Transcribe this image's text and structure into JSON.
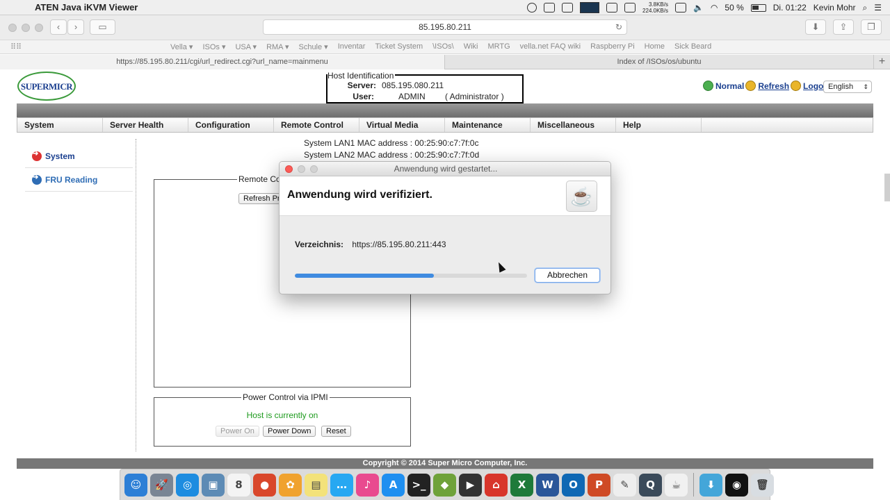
{
  "menubar": {
    "app_name": "ATEN Java iKVM Viewer",
    "net_up": "3.8KB/s",
    "net_down": "224.0KB/s",
    "battery": "50 %",
    "clock": "Di. 01:22",
    "user": "Kevin Mohr"
  },
  "browser": {
    "url": "85.195.80.211",
    "favorites": [
      "Vella ▾",
      "ISOs ▾",
      "USA ▾",
      "RMA ▾",
      "Schule ▾",
      "Inventar",
      "Ticket System",
      "\\ISOs\\",
      "Wiki",
      "MRTG",
      "vella.net FAQ wiki",
      "Raspberry Pi",
      "Home",
      "Sick Beard"
    ],
    "tabs": [
      "https://85.195.80.211/cgi/url_redirect.cgi?url_name=mainmenu",
      "Index of /ISOs/os/ubuntu"
    ]
  },
  "page": {
    "logo_text": "SUPERMICR",
    "host_legend": "Host Identification",
    "server_label": "Server:",
    "server_value": "085.195.080.211",
    "user_label": "User:",
    "user_value": "ADMIN",
    "user_role": "( Administrator )",
    "link_normal": "Normal",
    "link_refresh": "Refresh",
    "link_logout": "Logout",
    "language": "English",
    "nav": [
      "System",
      "Server Health",
      "Configuration",
      "Remote Control",
      "Virtual Media",
      "Maintenance",
      "Miscellaneous",
      "Help"
    ],
    "sidebar": [
      "System",
      "FRU Reading"
    ],
    "mac_lan1": "System LAN1 MAC address : 00:25:90:c7:7f:0c",
    "mac_lan2": "System LAN2 MAC address : 00:25:90:c7:7f:0d",
    "remote_legend": "Remote Co",
    "refresh_preview": "Refresh Pr",
    "power_legend": "Power Control via IPMI",
    "host_status": "Host is currently on",
    "power_on": "Power On",
    "power_down": "Power Down",
    "reset": "Reset",
    "copyright": "Copyright © 2014 Super Micro Computer, Inc."
  },
  "dialog": {
    "title": "Anwendung wird gestartet...",
    "heading": "Anwendung wird verifiziert.",
    "dir_label": "Verzeichnis:",
    "dir_value": "https://85.195.80.211:443",
    "progress": 0.6,
    "cancel": "Abbrechen"
  },
  "colors": {
    "status_green": "#1c9a1c",
    "link_blue": "#1a3f8f",
    "progress_blue": "#3f8be0"
  },
  "dock": [
    {
      "name": "finder-icon",
      "color": "#2d7fd6",
      "glyph": "☺"
    },
    {
      "name": "launchpad-icon",
      "color": "#7a8594",
      "glyph": "🚀"
    },
    {
      "name": "safari-icon",
      "color": "#1d8ce0",
      "glyph": "◎"
    },
    {
      "name": "preview-icon",
      "color": "#5d8bb5",
      "glyph": "▣"
    },
    {
      "name": "calendar-icon",
      "color": "#f4f4f4",
      "glyph": "8"
    },
    {
      "name": "reminders-icon",
      "color": "#d9472b",
      "glyph": "●"
    },
    {
      "name": "photos-icon",
      "color": "#f0a22e",
      "glyph": "✿"
    },
    {
      "name": "notes-icon",
      "color": "#f3e27a",
      "glyph": "▤"
    },
    {
      "name": "messages-icon",
      "color": "#27a8f2",
      "glyph": "…"
    },
    {
      "name": "itunes-icon",
      "color": "#e94a8f",
      "glyph": "♪"
    },
    {
      "name": "appstore-icon",
      "color": "#1f8ff0",
      "glyph": "A"
    },
    {
      "name": "terminal-icon",
      "color": "#222222",
      "glyph": ">_"
    },
    {
      "name": "android-icon",
      "color": "#6fa23a",
      "glyph": "◆"
    },
    {
      "name": "finalcut-icon",
      "color": "#333333",
      "glyph": "▶"
    },
    {
      "name": "remote-desktop-icon",
      "color": "#d8352b",
      "glyph": "⌂"
    },
    {
      "name": "excel-icon",
      "color": "#1f7a3a",
      "glyph": "X"
    },
    {
      "name": "word-icon",
      "color": "#2a5699",
      "glyph": "W"
    },
    {
      "name": "outlook-icon",
      "color": "#0f68b4",
      "glyph": "O"
    },
    {
      "name": "powerpoint-icon",
      "color": "#cf4a25",
      "glyph": "P"
    },
    {
      "name": "textedit-icon",
      "color": "#eeeeee",
      "glyph": "✎"
    },
    {
      "name": "quicktime-icon",
      "color": "#3a4a5a",
      "glyph": "Q"
    },
    {
      "name": "java-icon",
      "color": "#f1f1f1",
      "glyph": "☕"
    },
    {
      "name": "downloads-icon",
      "color": "#44a6d9",
      "glyph": "⬇"
    },
    {
      "name": "music-icon",
      "color": "#111111",
      "glyph": "◉"
    },
    {
      "name": "trash-icon",
      "color": "#d8dde2",
      "glyph": "🗑"
    }
  ]
}
